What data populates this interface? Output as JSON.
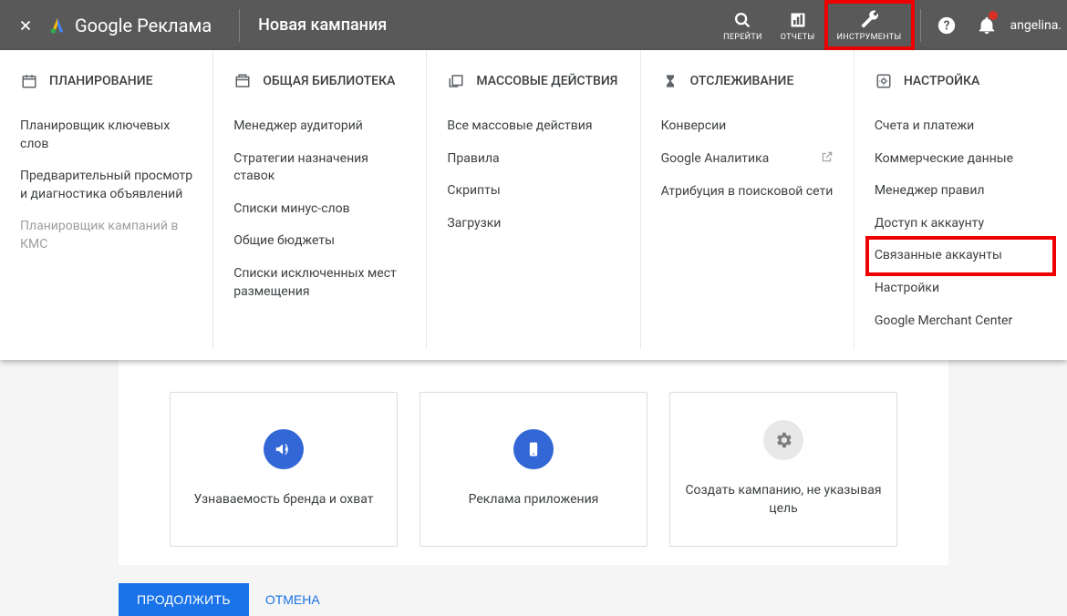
{
  "header": {
    "logo_text": "Google Реклама",
    "title": "Новая кампания",
    "tools": {
      "go": "ПЕРЕЙТИ",
      "reports": "ОТЧЕТЫ",
      "tools": "ИНСТРУМЕНТЫ"
    },
    "username": "angelina."
  },
  "menu": {
    "planning": {
      "title": "ПЛАНИРОВАНИЕ",
      "items": [
        "Планировщик ключевых слов",
        "Предварительный просмотр и диагностика объявлений",
        "Планировщик кампаний в КМС"
      ]
    },
    "library": {
      "title": "ОБЩАЯ БИБЛИОТЕКА",
      "items": [
        "Менеджер аудиторий",
        "Стратегии назначения ставок",
        "Списки минус-слов",
        "Общие бюджеты",
        "Списки исключенных мест размещения"
      ]
    },
    "bulk": {
      "title": "МАССОВЫЕ ДЕЙСТВИЯ",
      "items": [
        "Все массовые действия",
        "Правила",
        "Скрипты",
        "Загрузки"
      ]
    },
    "tracking": {
      "title": "ОТСЛЕЖИВАНИЕ",
      "items": [
        "Конверсии",
        "Google Аналитика",
        "Атрибуция в поисковой сети"
      ]
    },
    "setup": {
      "title": "НАСТРОЙКА",
      "items": [
        "Счета и платежи",
        "Коммерческие данные",
        "Менеджер правил",
        "Доступ к аккаунту",
        "Связанные аккаунты",
        "Настройки",
        "Google Merchant Center"
      ]
    }
  },
  "options": {
    "brand": "Узнаваемость бренда и охват",
    "app": "Реклама приложения",
    "nogoal": "Создать кампанию, не указывая цель"
  },
  "buttons": {
    "continue": "ПРОДОЛЖИТЬ",
    "cancel": "ОТМЕНА"
  }
}
